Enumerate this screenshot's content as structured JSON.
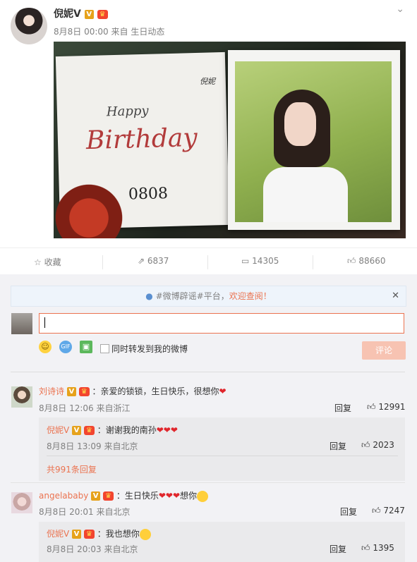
{
  "post": {
    "author": "倪妮V",
    "time": "8月8日 00:00",
    "source": "来自 生日动态",
    "image_text": {
      "happy": "Happy",
      "birthday": "Birthday",
      "date": "0808",
      "signature": "倪妮"
    }
  },
  "actions": {
    "favorite": "收藏",
    "repost": "6837",
    "comment": "14305",
    "like": "88660"
  },
  "notice": {
    "prefix": "#微博辟谣#平台，",
    "link": "欢迎查阅！"
  },
  "composer": {
    "sync_label": "同时转发到我的微博",
    "post_label": "评论"
  },
  "comments": [
    {
      "name": "刘诗诗",
      "text": "：亲爱的锁锁，生日快乐，很想你",
      "time": "8月8日 12:06 来自浙江",
      "reply": "回复",
      "likes": "12991",
      "sub": {
        "name": "倪妮V",
        "text": "：谢谢我的南孙",
        "time": "8月8日 13:09 来自北京",
        "reply": "回复",
        "likes": "2023"
      },
      "more": "共991条回复"
    },
    {
      "name": "angelababy",
      "text": "：生日快乐",
      "text2": "想你",
      "time": "8月8日 20:01 来自北京",
      "reply": "回复",
      "likes": "7247",
      "sub": {
        "name": "倪妮V",
        "text": "：我也想你",
        "time": "8月8日 20:03 来自北京",
        "reply": "回复",
        "likes": "1395"
      }
    }
  ],
  "colors": {
    "accent": "#eb7350",
    "heart": "#e0262c",
    "vip": "#e6a21b"
  }
}
